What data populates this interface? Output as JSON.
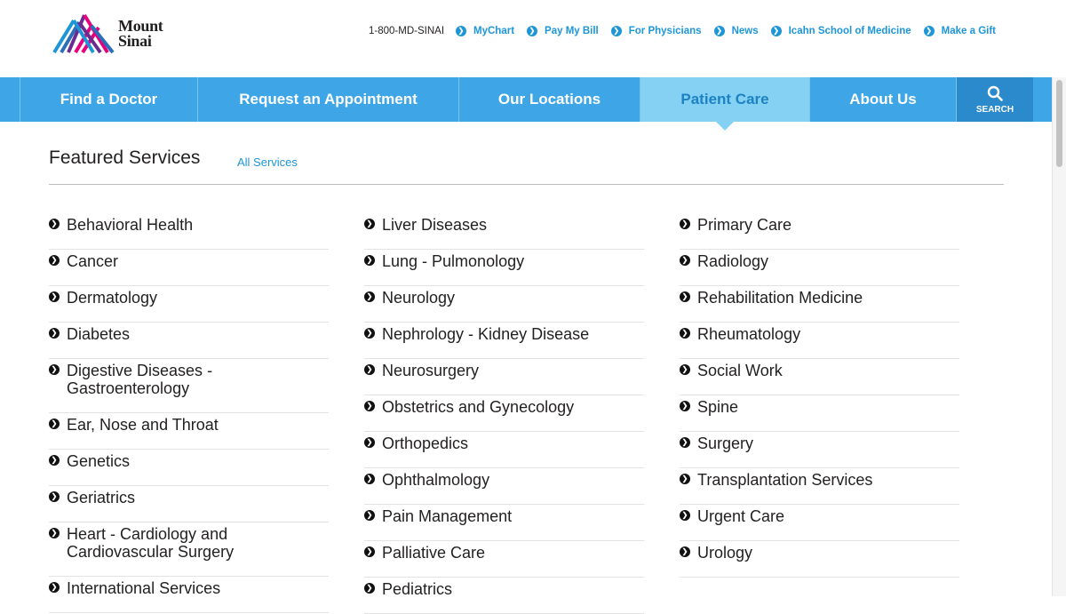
{
  "header": {
    "logo_line1": "Mount",
    "logo_line2": "Sinai",
    "phone": "1-800-MD-SINAI",
    "links": [
      "MyChart",
      "Pay My Bill",
      "For Physicians",
      "News",
      "Icahn School of Medicine",
      "Make a Gift"
    ]
  },
  "nav": {
    "items": [
      "Find a Doctor",
      "Request an Appointment",
      "Our Locations",
      "Patient Care",
      "About Us"
    ],
    "active": "Patient Care",
    "search_label": "SEARCH"
  },
  "main": {
    "heading": "Featured Services",
    "all_services": "All Services",
    "columns": [
      [
        "Behavioral Health",
        "Cancer",
        "Dermatology",
        "Diabetes",
        "Digestive Diseases - Gastroenterology",
        "Ear, Nose and Throat",
        "Genetics",
        "Geriatrics",
        "Heart - Cardiology and Cardiovascular Surgery",
        "International Services"
      ],
      [
        "Liver Diseases",
        "Lung - Pulmonology",
        "Neurology",
        "Nephrology - Kidney Disease",
        "Neurosurgery",
        "Obstetrics and Gynecology",
        "Orthopedics",
        "Ophthalmology",
        "Pain Management",
        "Palliative Care",
        "Pediatrics"
      ],
      [
        "Primary Care",
        "Radiology",
        "Rehabilitation Medicine",
        "Rheumatology",
        "Social Work",
        "Spine",
        "Surgery",
        "Transplantation Services",
        "Urgent Care",
        "Urology"
      ]
    ]
  },
  "colors": {
    "nav_bg": "#3ea6e6",
    "nav_active_bg": "#84d1f3",
    "search_bg": "#2a8acb",
    "link": "#1d96d8",
    "text": "#221f1f"
  },
  "icons": [
    "mount-sinai-logo",
    "chevron-right-circle-icon",
    "search-icon"
  ]
}
